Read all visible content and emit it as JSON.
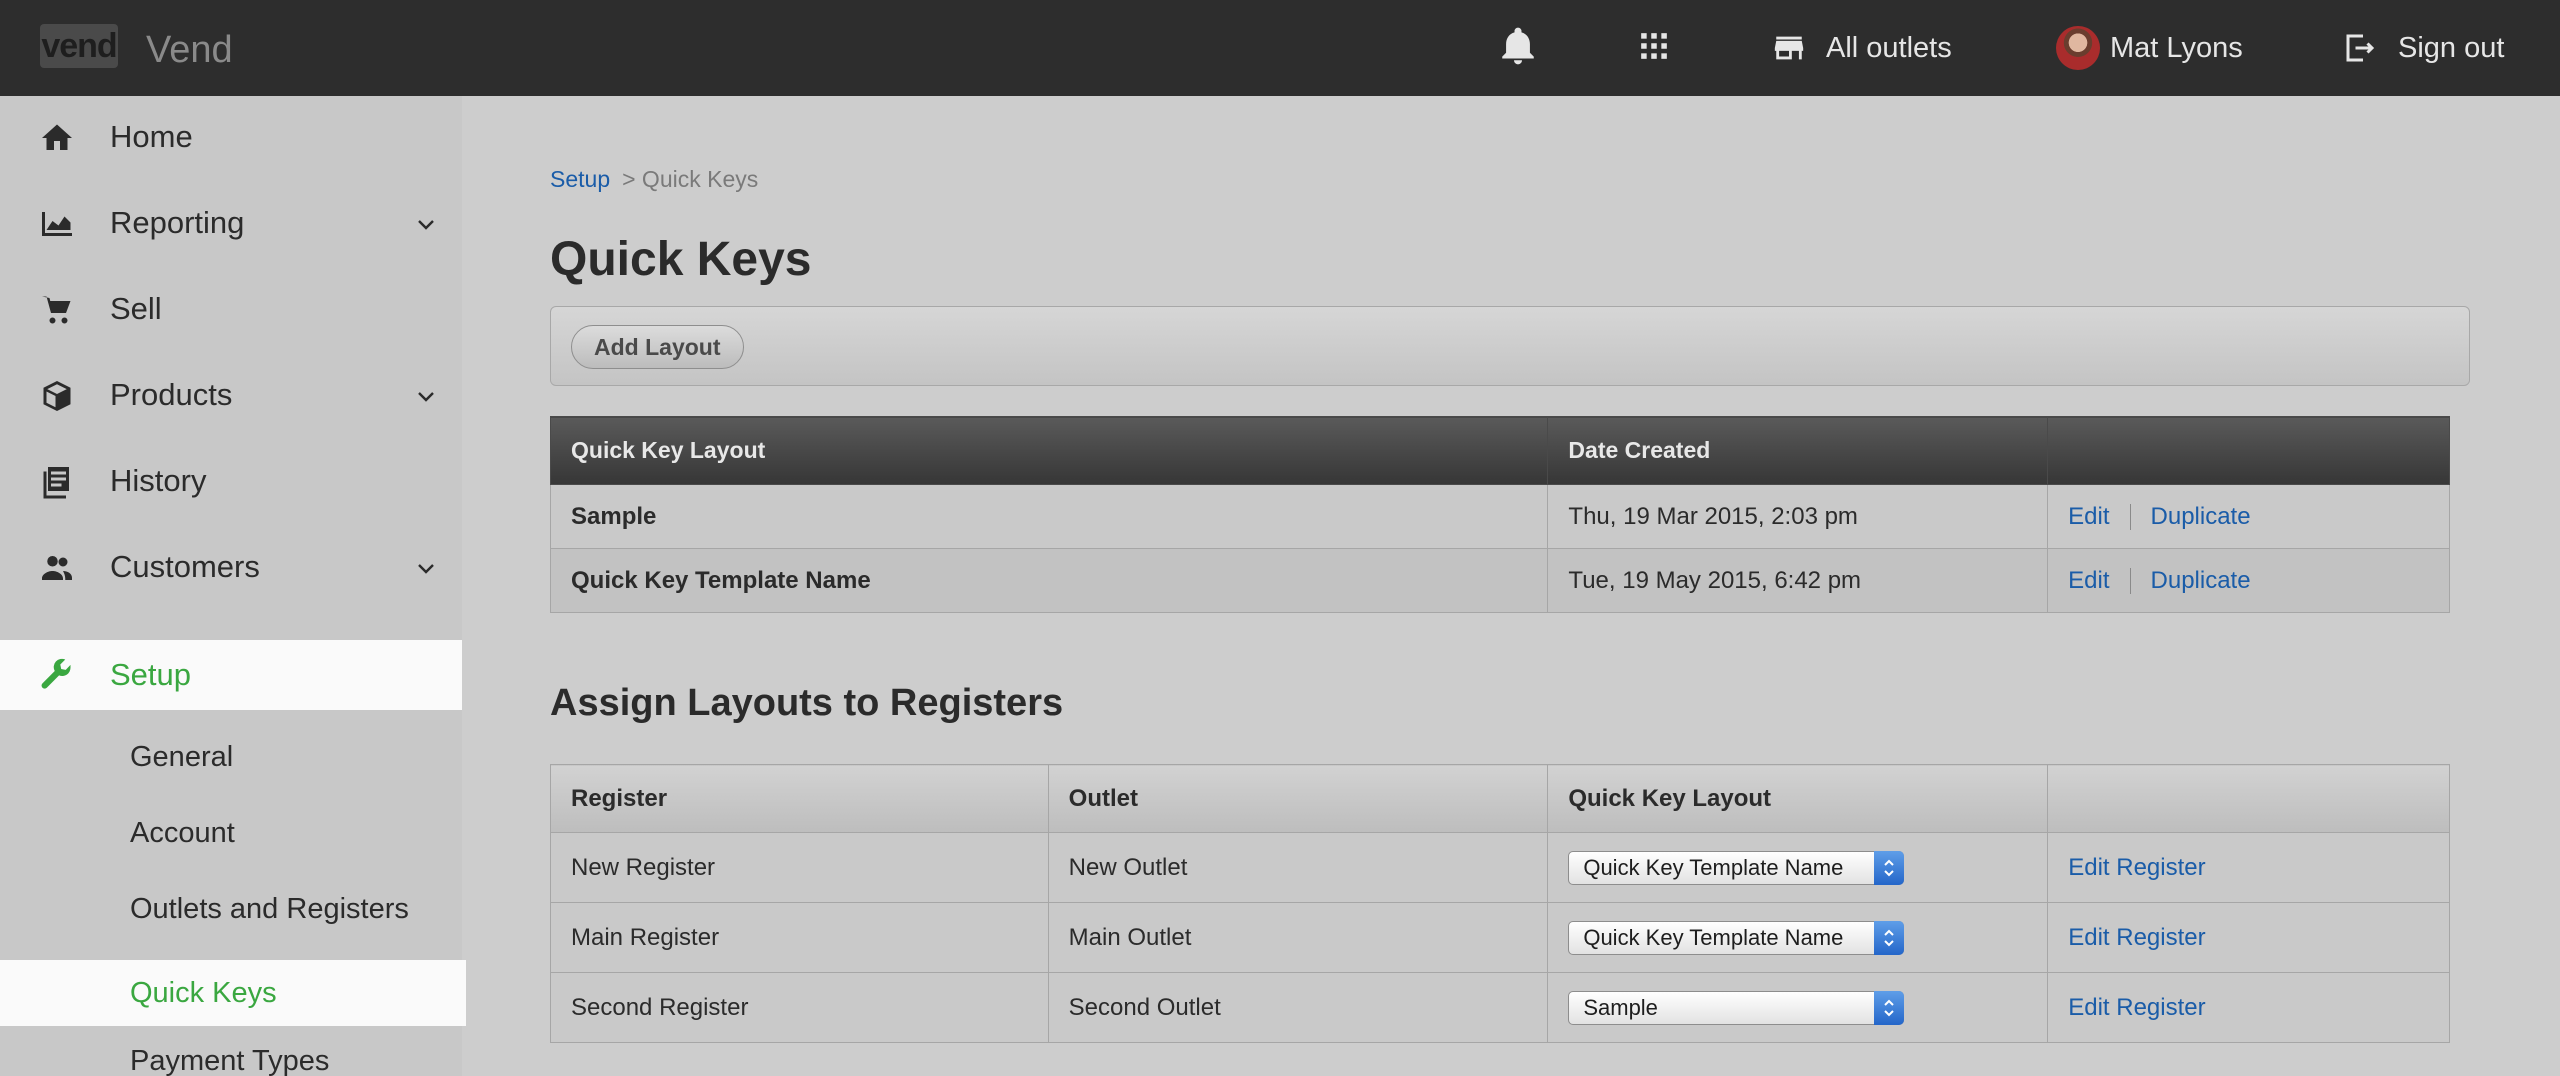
{
  "app": {
    "logo": "vend",
    "name": "Vend"
  },
  "topbar": {
    "outlets_label": "All outlets",
    "user_name": "Mat Lyons",
    "signout_label": "Sign out"
  },
  "sidebar": {
    "items": [
      {
        "label": "Home"
      },
      {
        "label": "Reporting"
      },
      {
        "label": "Sell"
      },
      {
        "label": "Products"
      },
      {
        "label": "History"
      },
      {
        "label": "Customers"
      },
      {
        "label": "Setup"
      }
    ],
    "setup_sub": [
      {
        "label": "General"
      },
      {
        "label": "Account"
      },
      {
        "label": "Outlets and Registers"
      },
      {
        "label": "Quick Keys"
      },
      {
        "label": "Payment Types"
      }
    ]
  },
  "breadcrumb": {
    "root": "Setup",
    "current": "> Quick Keys"
  },
  "page": {
    "title": "Quick Keys",
    "add_layout_label": "Add Layout"
  },
  "layouts_table": {
    "headers": [
      "Quick Key Layout",
      "Date Created",
      ""
    ],
    "rows": [
      {
        "name": "Sample",
        "date": "Thu, 19 Mar 2015, 2:03 pm",
        "edit": "Edit",
        "duplicate": "Duplicate"
      },
      {
        "name": "Quick Key Template Name",
        "date": "Tue, 19 May 2015, 6:42 pm",
        "edit": "Edit",
        "duplicate": "Duplicate"
      }
    ]
  },
  "assign": {
    "title": "Assign Layouts to Registers",
    "headers": [
      "Register",
      "Outlet",
      "Quick Key Layout",
      ""
    ],
    "rows": [
      {
        "register": "New Register",
        "outlet": "New Outlet",
        "layout": "Quick Key Template Name",
        "action": "Edit Register"
      },
      {
        "register": "Main Register",
        "outlet": "Main Outlet",
        "layout": "Quick Key Template Name",
        "action": "Edit Register"
      },
      {
        "register": "Second Register",
        "outlet": "Second Outlet",
        "layout": "Sample",
        "action": "Edit Register"
      }
    ]
  },
  "colors": {
    "accent_green": "#3aa740",
    "link_blue": "#1a5ca8",
    "topbar_bg": "#2d2d2d"
  }
}
